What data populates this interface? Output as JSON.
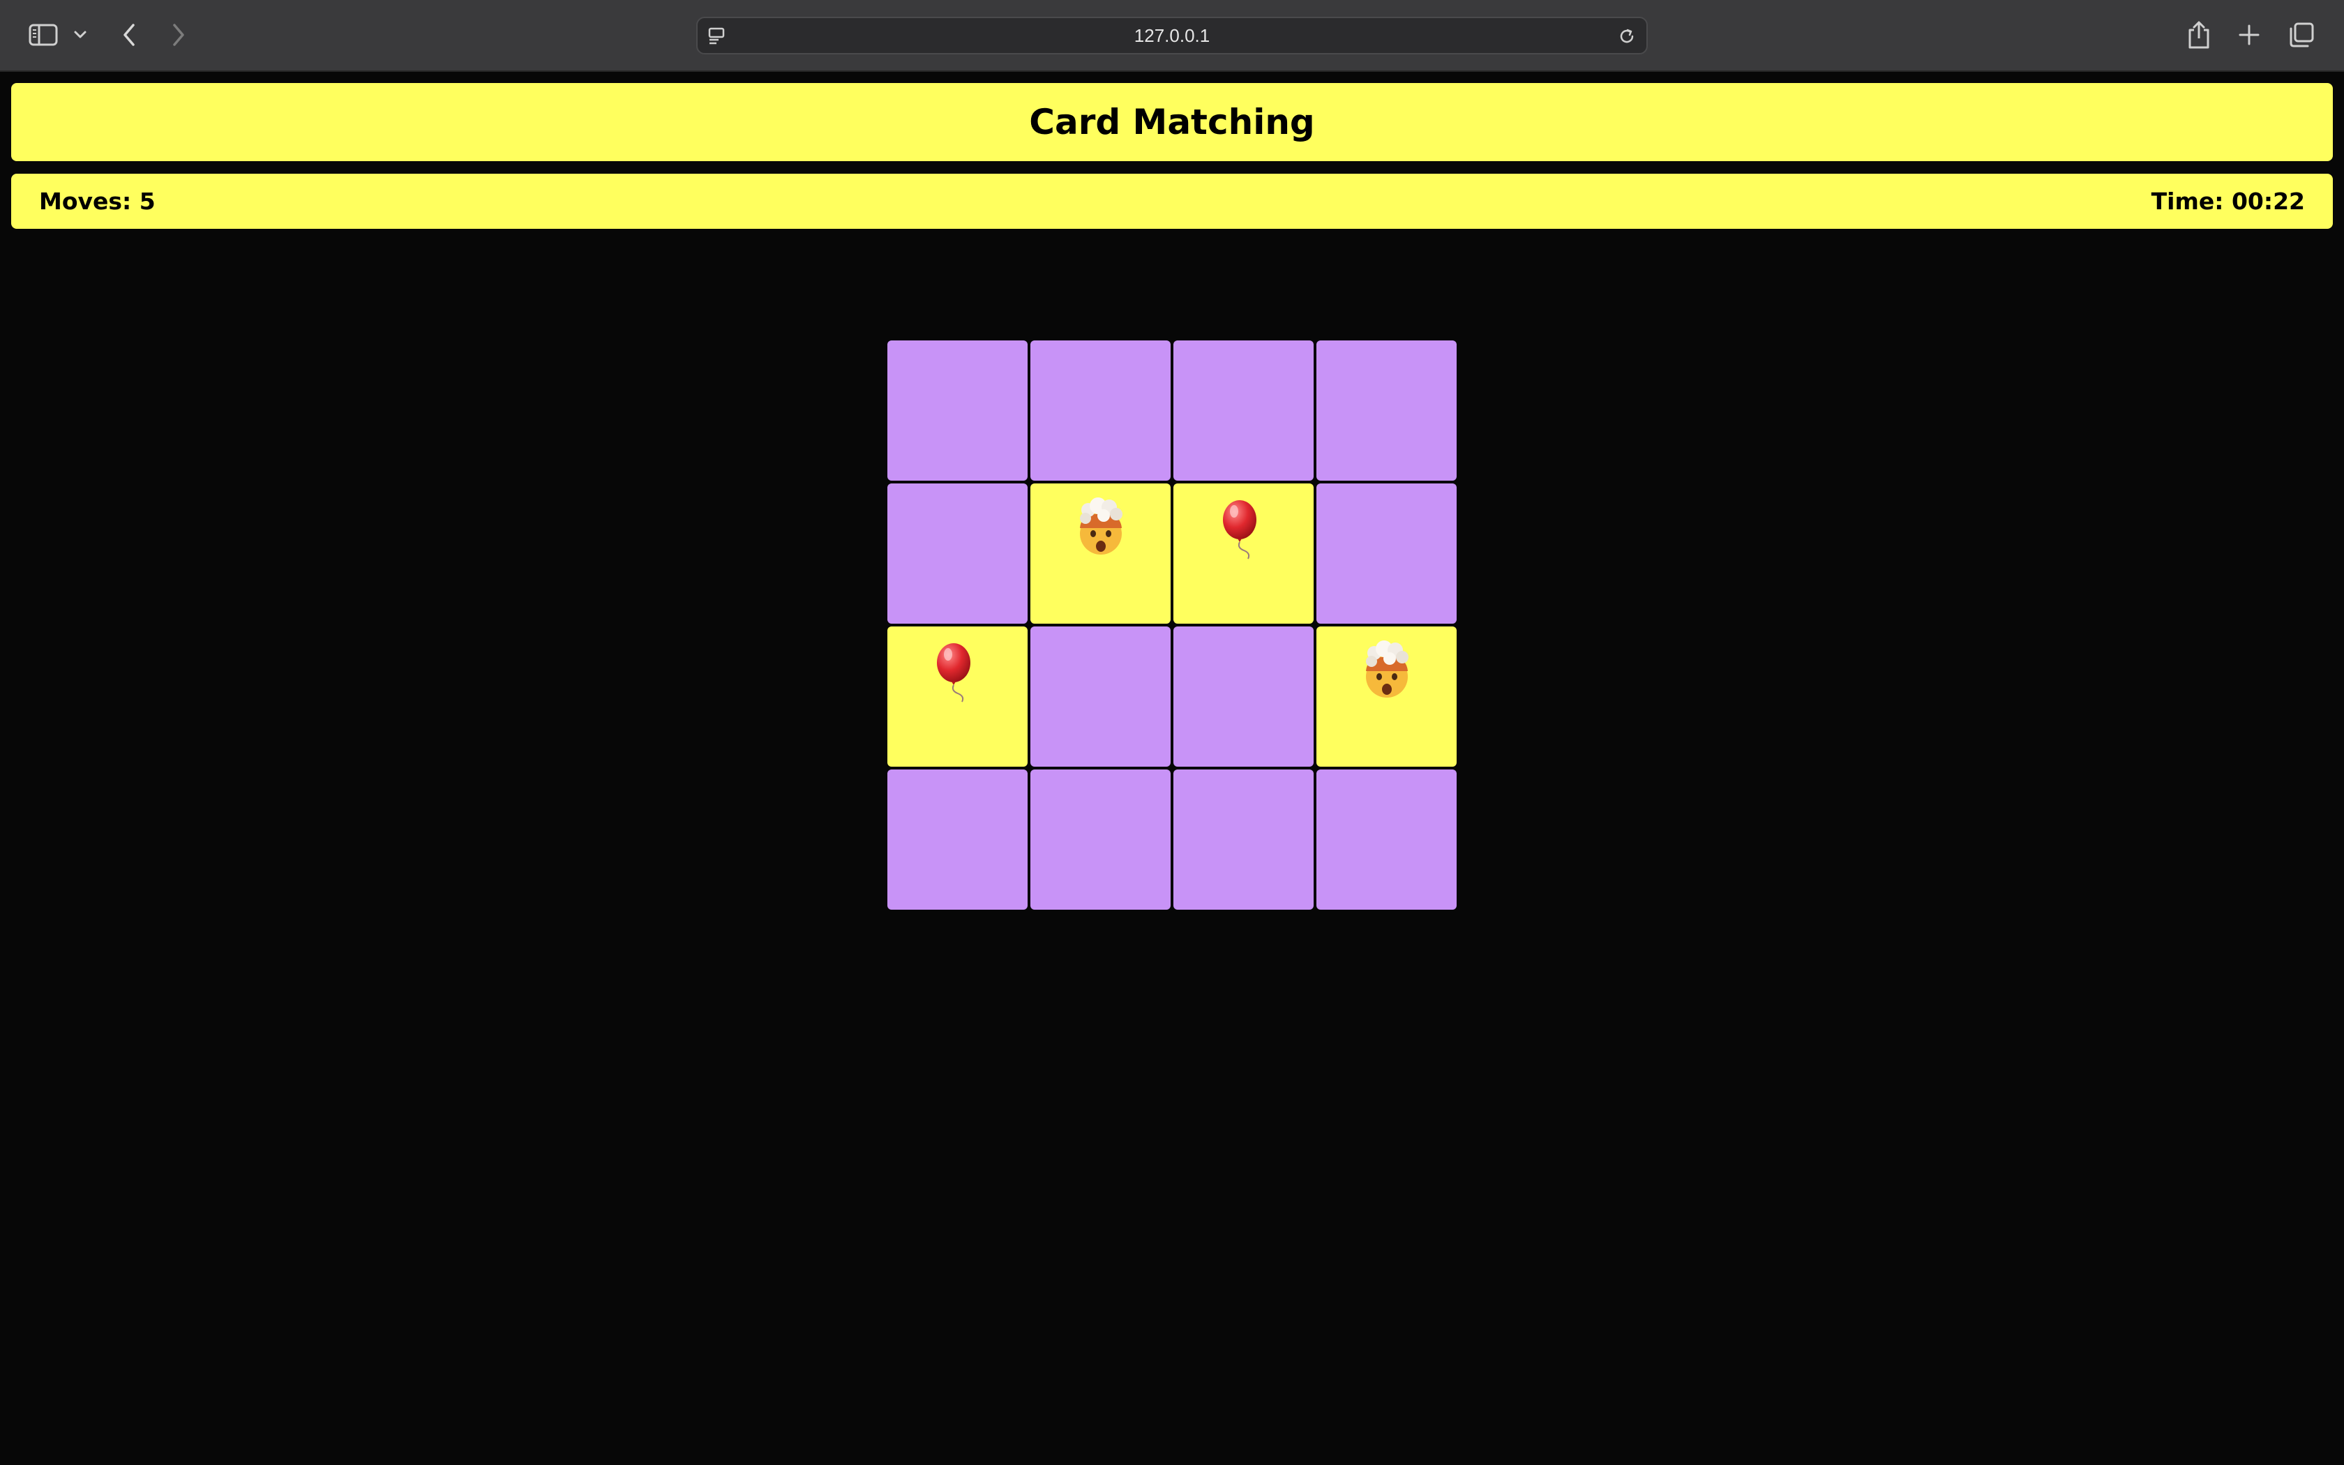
{
  "browser": {
    "url": "127.0.0.1"
  },
  "game": {
    "title": "Card Matching",
    "moves_label": "Moves: 5",
    "time_label": "Time: 00:22",
    "colors": {
      "hidden_card": "#c893f7",
      "revealed_card": "#ffff5e",
      "panel": "#ffff5e",
      "background": "#070707"
    },
    "cards": [
      {
        "state": "hidden"
      },
      {
        "state": "hidden"
      },
      {
        "state": "hidden"
      },
      {
        "state": "hidden"
      },
      {
        "state": "hidden"
      },
      {
        "state": "revealed",
        "icon": "exploding-head-icon"
      },
      {
        "state": "revealed",
        "icon": "balloon-icon"
      },
      {
        "state": "hidden"
      },
      {
        "state": "revealed",
        "icon": "balloon-icon"
      },
      {
        "state": "hidden"
      },
      {
        "state": "hidden"
      },
      {
        "state": "revealed",
        "icon": "exploding-head-icon"
      },
      {
        "state": "hidden"
      },
      {
        "state": "hidden"
      },
      {
        "state": "hidden"
      },
      {
        "state": "hidden"
      }
    ]
  }
}
